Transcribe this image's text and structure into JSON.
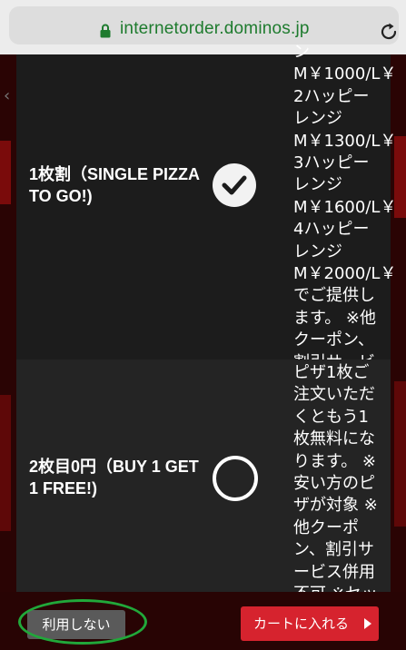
{
  "browser": {
    "url": "internetorder.dominos.jp",
    "lock_icon": "lock-icon",
    "reload_icon": "reload-icon"
  },
  "options": [
    {
      "title": "1枚割（SINGLE PIZZA TO GO!)",
      "selected": true,
      "description": "ン\nM￥1000/L￥\n2ハッピー\nレンジ\nM￥1300/L￥\n3ハッピー\nレンジ\nM￥1600/L￥\n4ハッピー\nレンジ\nM￥2000/L￥\nでご提供し\nます。 ※他\nクーポン、\n割引サービ\nス併用不可\n※セット商\n品対象外"
    },
    {
      "title": "2枚目0円（BUY 1 GET 1 FREE!)",
      "selected": false,
      "description": "ピザ1枚ご\n注文いただ\nくともう1\n枚無料にな\nります。 ※\n安い方のピ\nザが対象 ※\n他クーポ\nン、割引サ\nービス併用\n不可 ※セッ\nト商品対象\n外"
    }
  ],
  "footer": {
    "decline_label": "利用しない",
    "add_to_cart_label": "カートに入れる"
  },
  "colors": {
    "url_green": "#1e7b2e",
    "cart_red": "#d6232e",
    "highlight_green": "#21a83a"
  }
}
